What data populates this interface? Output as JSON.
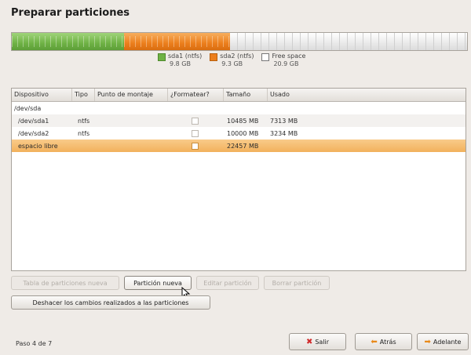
{
  "page": {
    "title": "Preparar particiones",
    "step": "Paso 4 de 7"
  },
  "partition_bar": {
    "segments": [
      {
        "id": "sda1",
        "fraction": 0.247,
        "color": "#6fb245"
      },
      {
        "id": "sda2",
        "fraction": 0.233,
        "color": "#ec7f1d"
      },
      {
        "id": "free",
        "fraction": 0.52,
        "color": "#e8e8e8"
      }
    ]
  },
  "legend": [
    {
      "label": "sda1 (ntfs)",
      "size": "9.8 GB",
      "color": "#6fb245"
    },
    {
      "label": "sda2 (ntfs)",
      "size": "9.3 GB",
      "color": "#ec7f1d"
    },
    {
      "label": "Free space",
      "size": "20.9 GB",
      "color": "#ffffff"
    }
  ],
  "table": {
    "columns": [
      "Dispositivo",
      "Tipo",
      "Punto de montaje",
      "¿Formatear?",
      "Tamaño",
      "Usado"
    ],
    "rows": [
      {
        "device": "/dev/sda",
        "type": "",
        "mount": "",
        "format": "",
        "size": "",
        "used": ""
      },
      {
        "device": "/dev/sda1",
        "type": "ntfs",
        "mount": "",
        "format": "checkbox",
        "size": "10485 MB",
        "used": "7313 MB"
      },
      {
        "device": "/dev/sda2",
        "type": "ntfs",
        "mount": "",
        "format": "checkbox",
        "size": "10000 MB",
        "used": "3234 MB"
      },
      {
        "device": "espacio libre",
        "type": "",
        "mount": "",
        "format": "checkbox",
        "size": "22457 MB",
        "used": ""
      }
    ]
  },
  "actions": {
    "new_table": "Tabla de particiones nueva",
    "new_partition": "Partición nueva",
    "edit_partition": "Editar partición",
    "delete_partition": "Borrar partición",
    "undo": "Deshacer los cambios realizados a las particiones"
  },
  "nav": {
    "quit": "Salir",
    "back": "Atrás",
    "forward": "Adelante"
  }
}
